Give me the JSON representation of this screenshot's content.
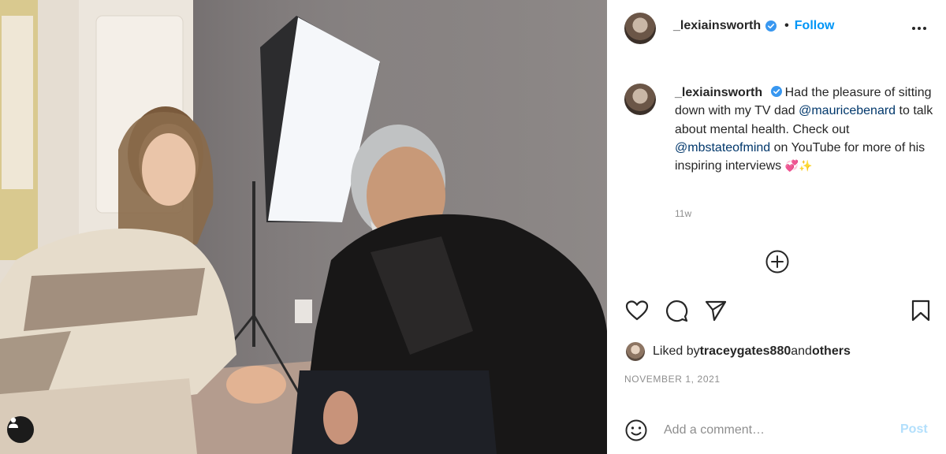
{
  "header": {
    "username": "_lexiainsworth",
    "separator": "•",
    "follow_label": "Follow",
    "more_icon": "more-horizontal-icon"
  },
  "caption": {
    "username": "_lexiainsworth",
    "text_1": "Had the pleasure of sitting down with my TV dad ",
    "mention_1": "@mauricebenard",
    "text_2": " to talk about mental health. Check out ",
    "mention_2": "@mbstateofmind",
    "text_3": " on YouTube for more of his inspiring interviews ",
    "emoji": "💞✨",
    "time_ago": "11w"
  },
  "likes": {
    "prefix": "Liked by ",
    "user": "traceygates880",
    "middle": " and ",
    "others": "others"
  },
  "date": "NOVEMBER 1, 2021",
  "comment": {
    "placeholder": "Add a comment…",
    "post_label": "Post"
  },
  "colors": {
    "accent": "#0095f6",
    "verified": "#3897f0",
    "mention": "#00376b",
    "muted": "#8e8e8e",
    "post_disabled": "#b2dffc"
  }
}
